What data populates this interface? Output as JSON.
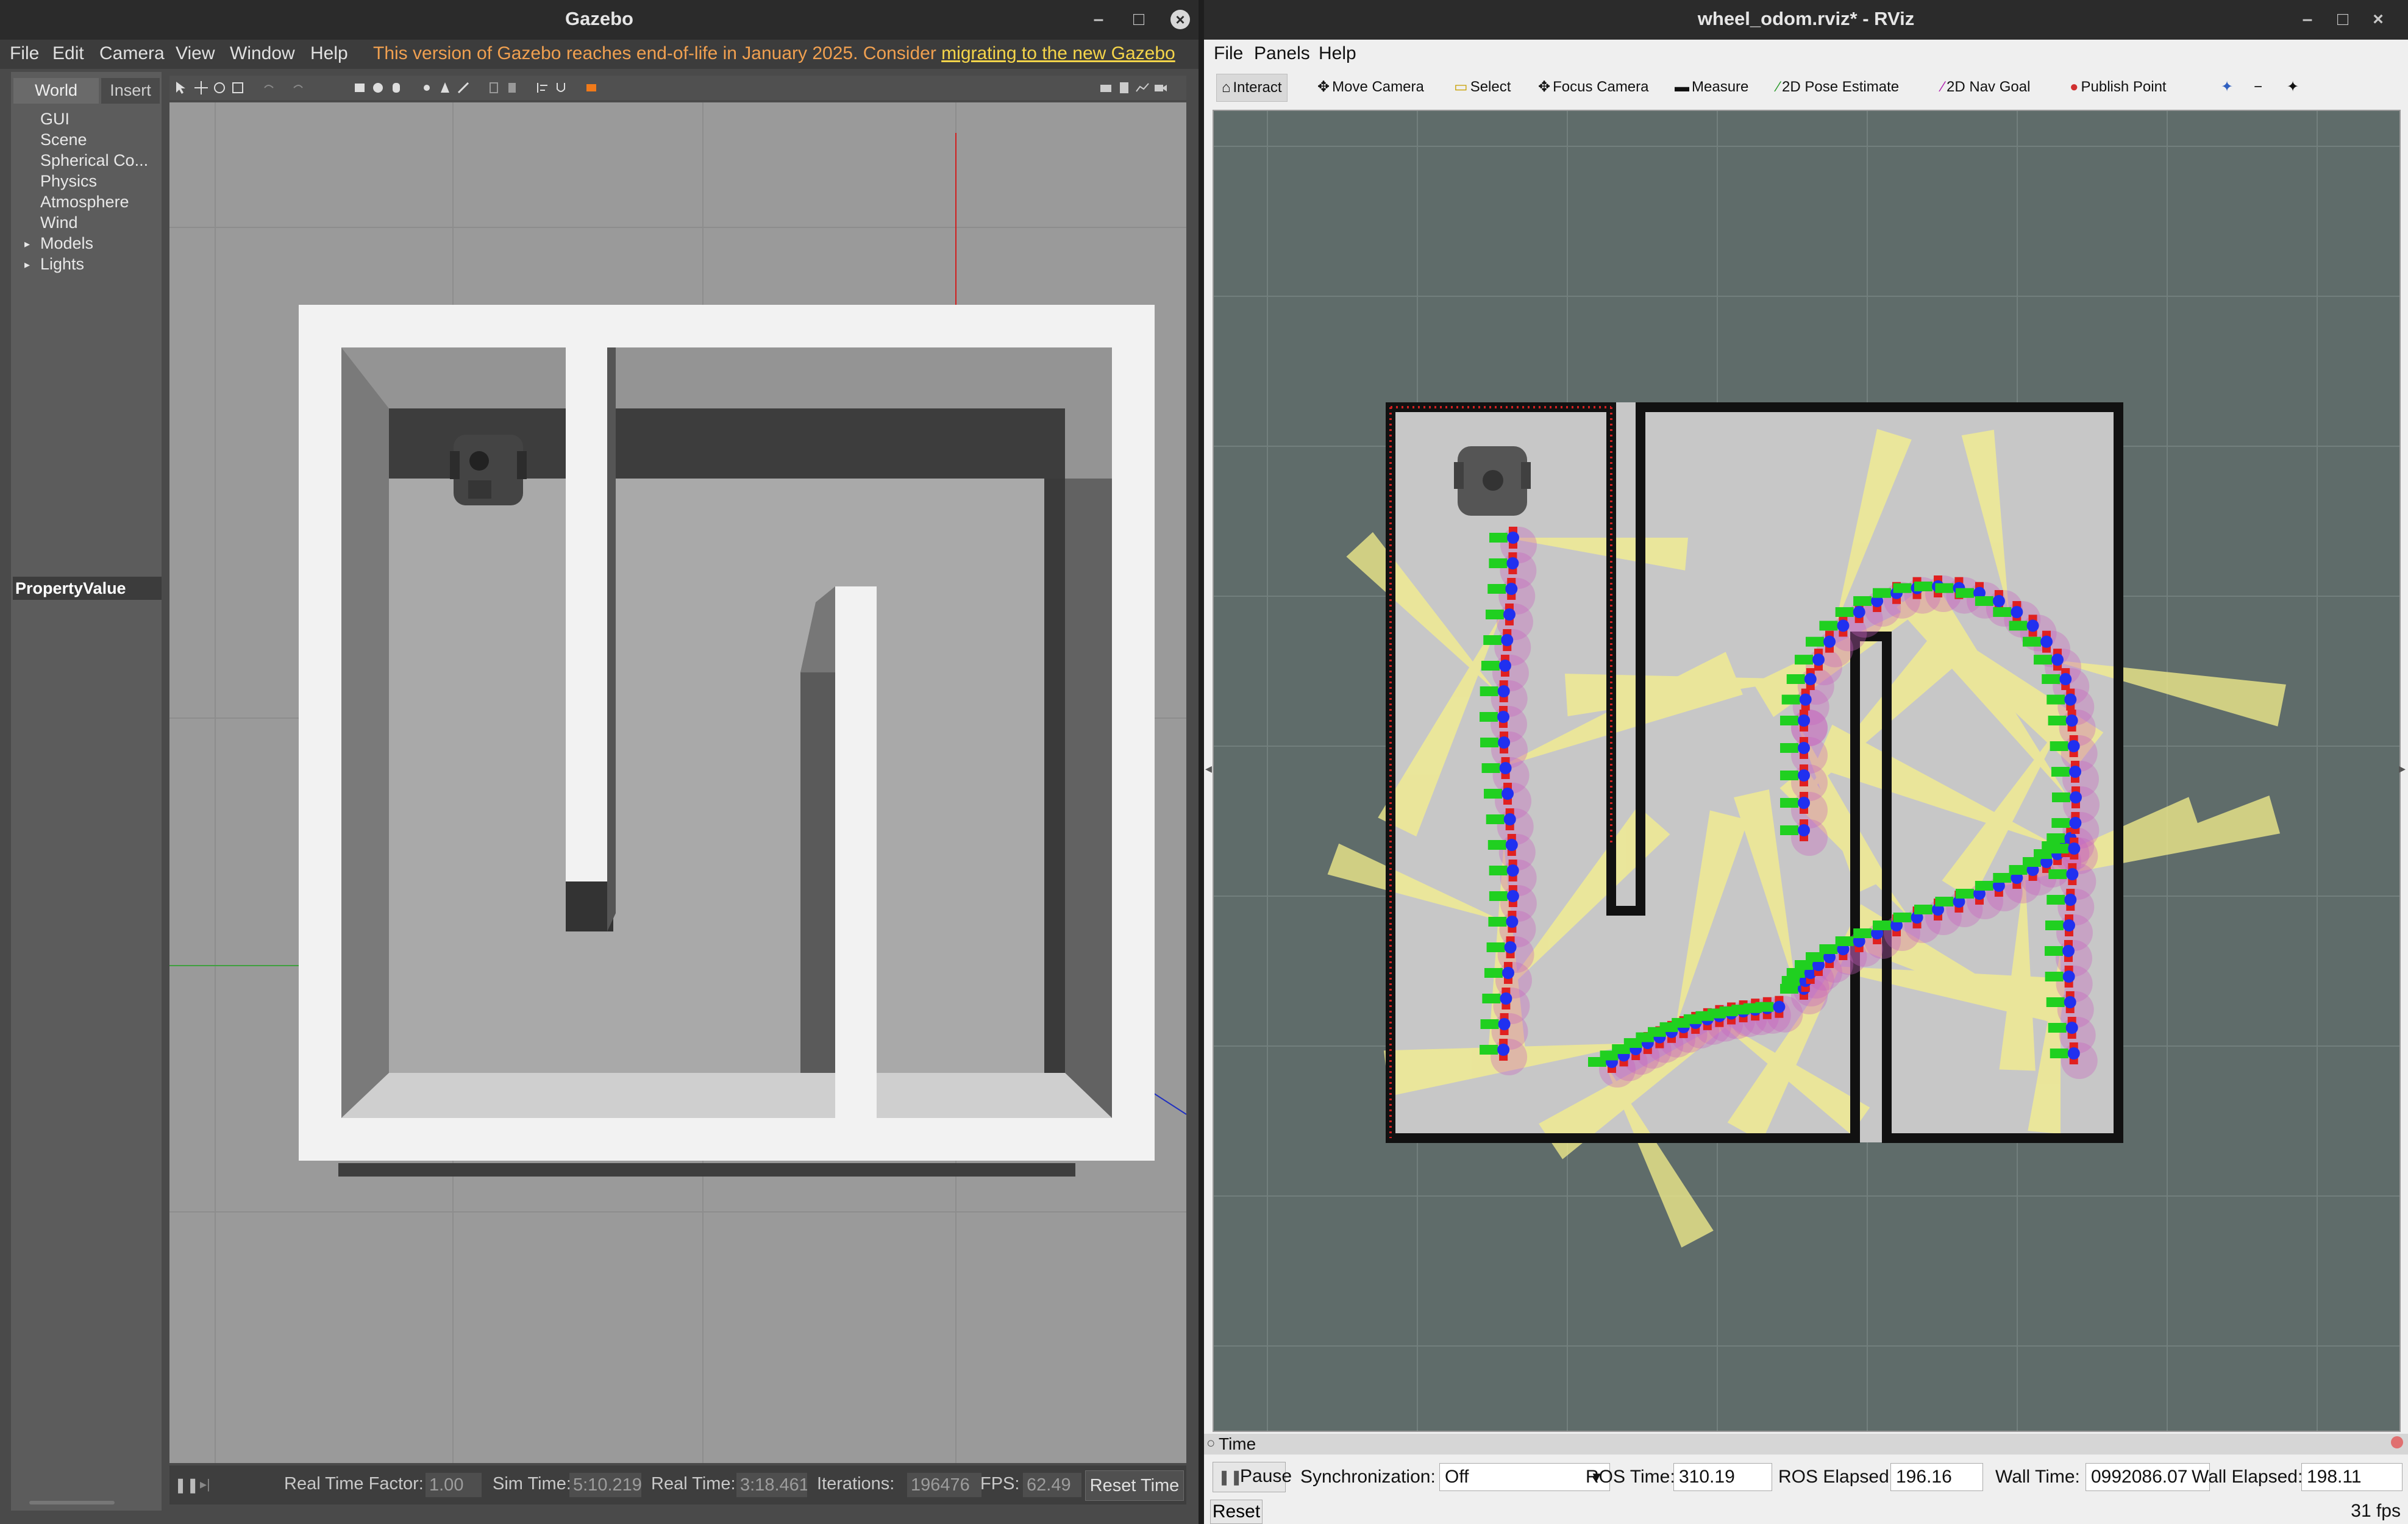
{
  "gazebo": {
    "title": "Gazebo",
    "menu": [
      "File",
      "Edit",
      "Camera",
      "View",
      "Window",
      "Help"
    ],
    "notice_text": "This version of Gazebo reaches end-of-life in January 2025. Consider ",
    "notice_link": "migrating to the new Gazebo",
    "tabs": [
      "World",
      "Insert"
    ],
    "world_tree": [
      "GUI",
      "Scene",
      "Spherical Co...",
      "Physics",
      "Atmosphere",
      "Wind",
      "Models",
      "Lights"
    ],
    "property_header": "PropertyValue",
    "status": {
      "rtf_label": "Real Time Factor:",
      "rtf_value": "1.00",
      "sim_label": "Sim Time:",
      "sim_value": "5:10.219",
      "real_label": "Real Time:",
      "real_value": "3:18.461",
      "iter_label": "Iterations:",
      "iter_value": "196476",
      "fps_label": "FPS:",
      "fps_value": "62.49",
      "reset_label": "Reset Time"
    }
  },
  "rviz": {
    "title": "wheel_odom.rviz* - RViz",
    "menu": [
      "File",
      "Panels",
      "Help"
    ],
    "tools": [
      "Interact",
      "Move Camera",
      "Select",
      "Focus Camera",
      "Measure",
      "2D Pose Estimate",
      "2D Nav Goal",
      "Publish Point"
    ],
    "time_panel": {
      "header": "Time",
      "pause_label": "Pause",
      "sync_label": "Synchronization:",
      "sync_value": "Off",
      "ros_time_label": "ROS Time:",
      "ros_time_value": "310.19",
      "ros_elapsed_label": "ROS Elapsed:",
      "ros_elapsed_value": "196.16",
      "wall_time_label": "Wall Time:",
      "wall_time_value": "0992086.07",
      "wall_elapsed_label": "Wall Elapsed:",
      "wall_elapsed_value": "198.11"
    },
    "reset_label": "Reset",
    "fps": "31 fps"
  }
}
